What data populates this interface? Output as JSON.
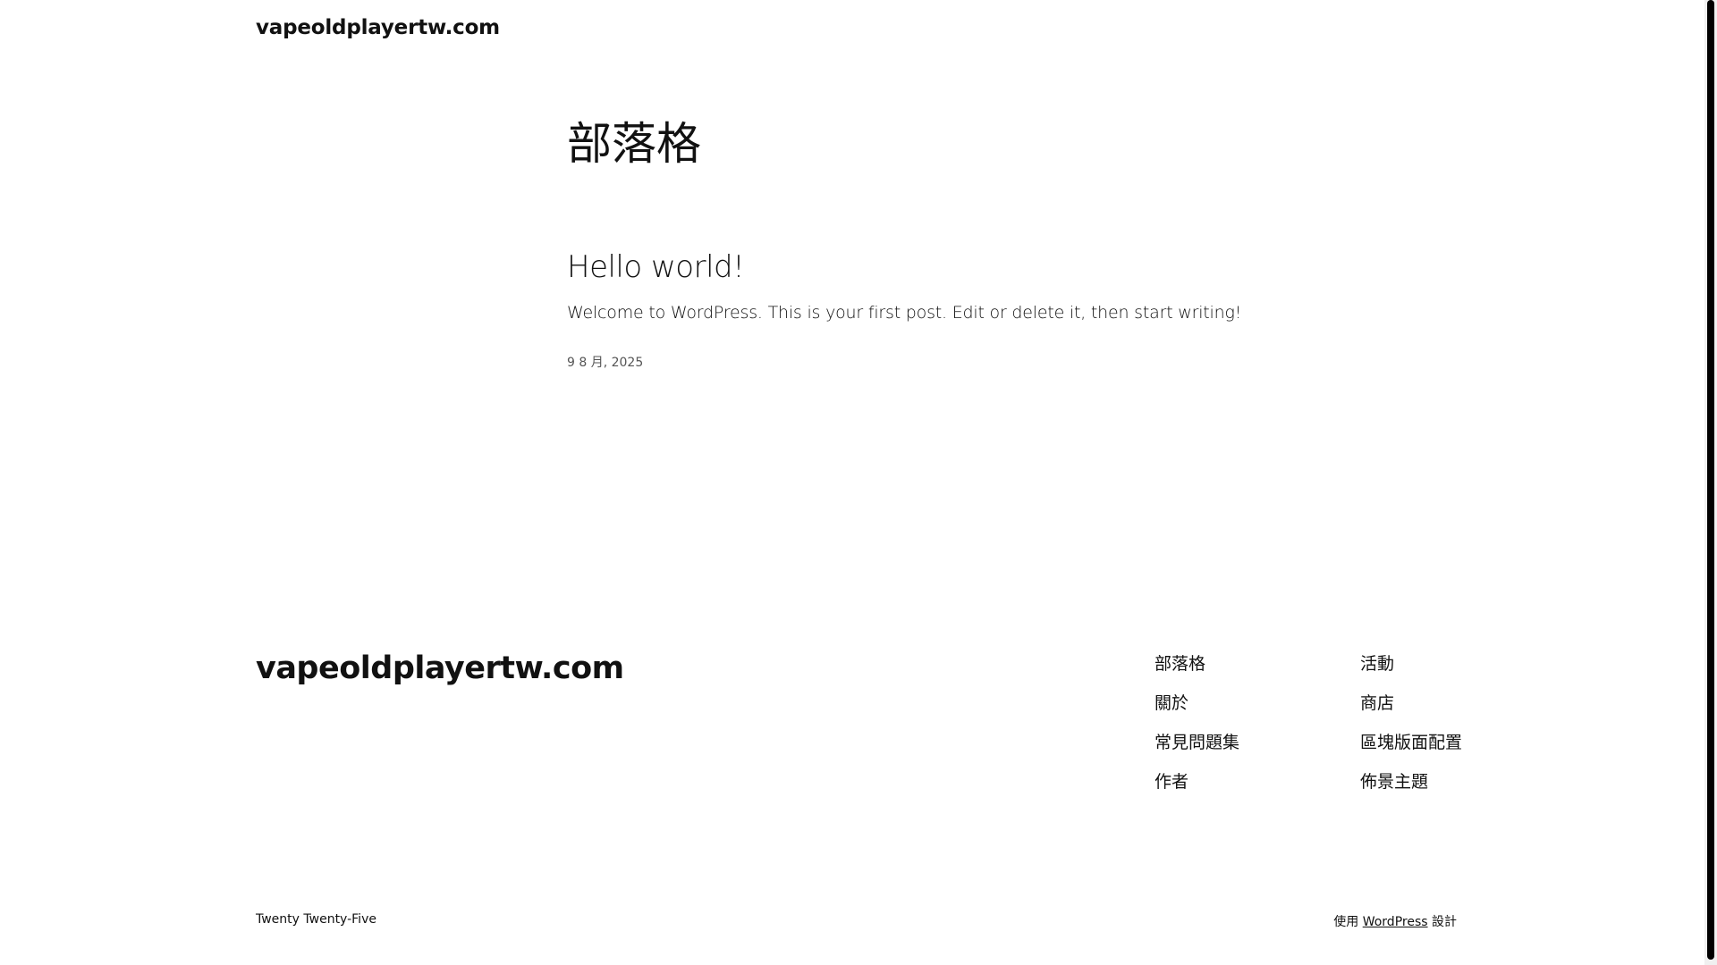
{
  "header": {
    "site_title": "vapeoldplayertw.com"
  },
  "main": {
    "archive_title": "部落格",
    "post": {
      "title": "Hello world!",
      "excerpt": "Welcome to WordPress. This is your first post. Edit or delete it, then start writing!",
      "date": "9 8 月, 2025"
    }
  },
  "footer": {
    "site_title": "vapeoldplayertw.com",
    "nav_col_1": [
      "部落格",
      "關於",
      "常見問題集",
      "作者"
    ],
    "nav_col_2": [
      "活動",
      "商店",
      "區塊版面配置",
      "佈景主題"
    ],
    "theme_name": "Twenty Twenty-Five",
    "credit_prefix": "使用",
    "credit_link": "WordPress",
    "credit_suffix": "設計"
  }
}
